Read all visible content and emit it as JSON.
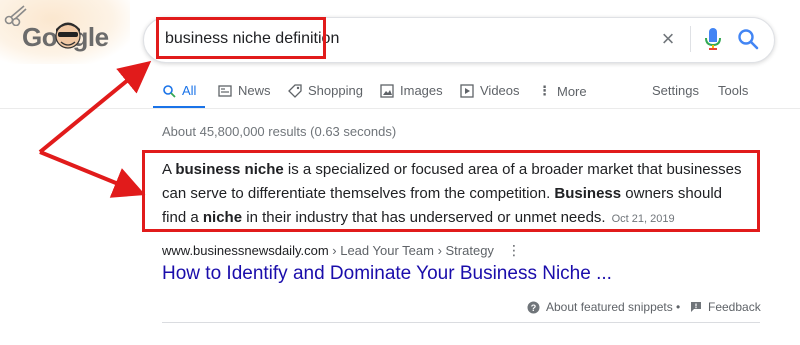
{
  "logo": {
    "text_g": "Go",
    "text_oo": "o",
    "text_rest": "gle"
  },
  "search": {
    "query": "business niche definition"
  },
  "icons": {
    "clear": "close-icon",
    "mic": "mic-icon",
    "search": "search-icon"
  },
  "tabs": {
    "all": "All",
    "news": "News",
    "shopping": "Shopping",
    "images": "Images",
    "videos": "Videos",
    "more": "More",
    "settings": "Settings",
    "tools": "Tools"
  },
  "result_stats": "About 45,800,000 results (0.63 seconds)",
  "snippet": {
    "p1": "A ",
    "b1": "business niche",
    "p2": " is a specialized or focused area of a broader market that businesses can serve to differentiate themselves from the competition. ",
    "b2": "Business",
    "p3": " owners should find a ",
    "b3": "niche",
    "p4": " in their industry that has underserved or unmet needs.",
    "date": "Oct 21, 2019"
  },
  "result": {
    "domain": "www.businessnewsdaily.com",
    "breadcrumb": " › Lead Your Team › Strategy",
    "more": "⋮",
    "title": "How to Identify and Dominate Your Business Niche ..."
  },
  "footer": {
    "about": "About featured snippets",
    "separator": "•",
    "feedback": "Feedback"
  },
  "colors": {
    "accent": "#1a73e8",
    "link": "#1a0dab",
    "annotation_red": "#e11b1b"
  }
}
